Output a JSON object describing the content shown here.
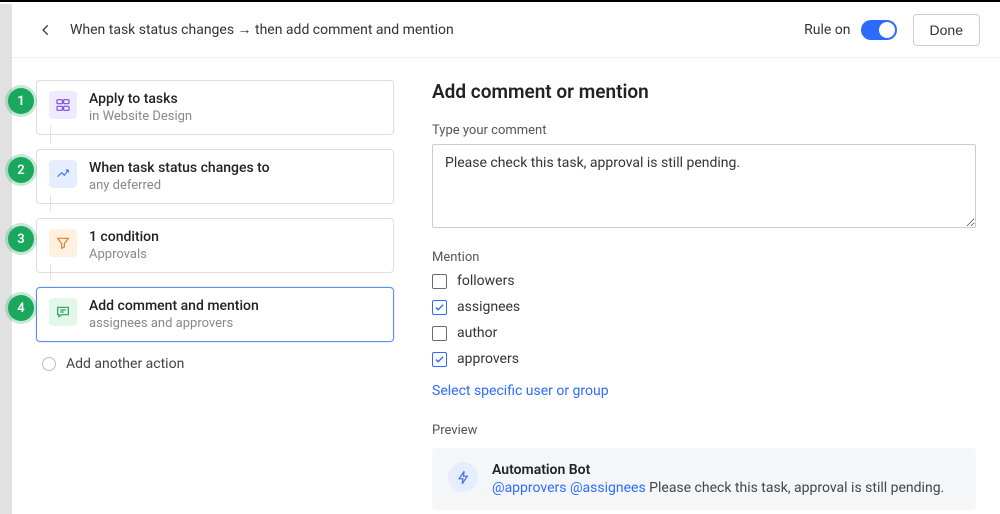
{
  "header": {
    "breadcrumb": "When task status changes → then add comment and mention",
    "rule_on_label": "Rule on",
    "done_label": "Done"
  },
  "steps": [
    {
      "num": "1",
      "title": "Apply to tasks",
      "sub": "in Website Design",
      "icon": "scope-icon",
      "color": "icon-purple"
    },
    {
      "num": "2",
      "title": "When task status changes to",
      "sub": "any deferred",
      "icon": "trigger-icon",
      "color": "icon-blue"
    },
    {
      "num": "3",
      "title": "1 condition",
      "sub": "Approvals",
      "icon": "filter-icon",
      "color": "icon-orange"
    },
    {
      "num": "4",
      "title": "Add comment and mention",
      "sub": "assignees and approvers",
      "icon": "comment-icon",
      "color": "icon-green",
      "selected": true
    }
  ],
  "add_action_label": "Add another action",
  "panel": {
    "title": "Add comment or mention",
    "comment_label": "Type your comment",
    "comment_value": "Please check this task, approval is still pending.",
    "mention_label": "Mention",
    "mentions": [
      {
        "label": "followers",
        "checked": false
      },
      {
        "label": "assignees",
        "checked": true
      },
      {
        "label": "author",
        "checked": false
      },
      {
        "label": "approvers",
        "checked": true
      }
    ],
    "select_link": "Select specific user or group",
    "preview_label": "Preview",
    "preview_title": "Automation Bot",
    "preview_mentions": "@approvers @assignees",
    "preview_body": "Please check this task, approval is still pending."
  }
}
